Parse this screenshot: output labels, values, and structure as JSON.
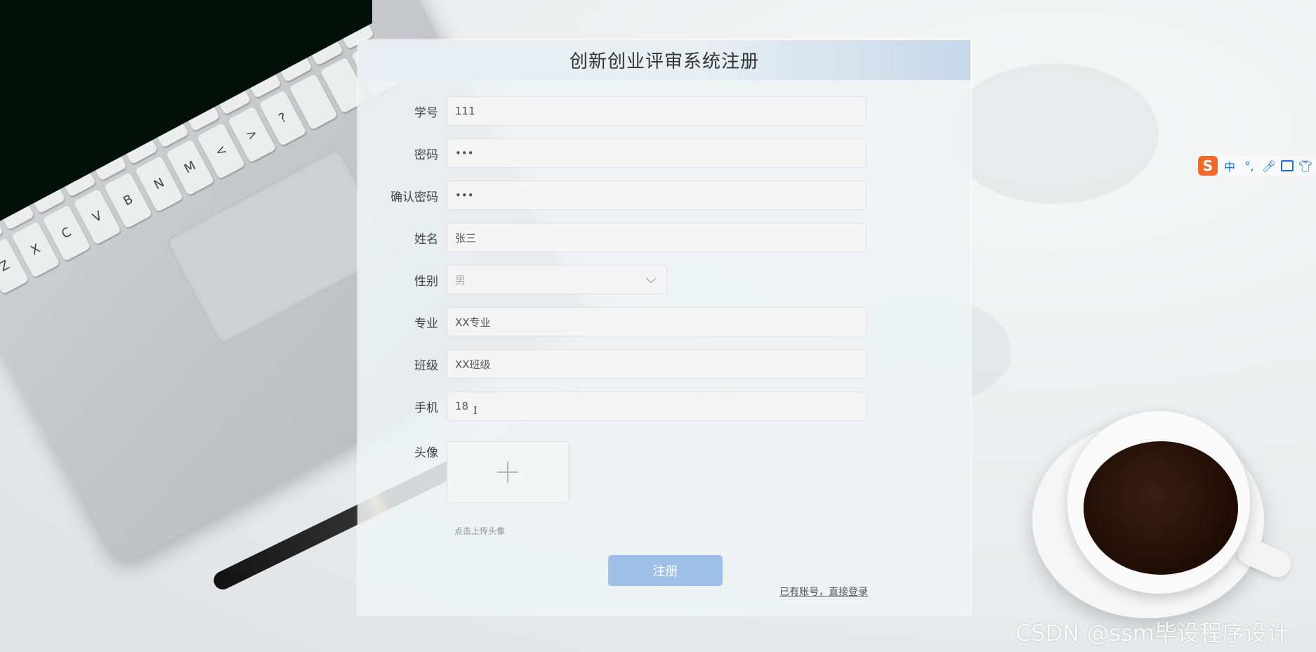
{
  "page": {
    "title": "创新创业评审系统注册"
  },
  "form": {
    "fields": [
      {
        "label": "学号",
        "value": "111"
      },
      {
        "label": "密码",
        "value": "•••"
      },
      {
        "label": "确认密码",
        "value": "•••"
      },
      {
        "label": "姓名",
        "value": "张三"
      },
      {
        "label": "性别",
        "value": "男"
      },
      {
        "label": "专业",
        "value": "XX专业"
      },
      {
        "label": "班级",
        "value": "XX班级"
      },
      {
        "label": "手机",
        "value": "18"
      }
    ],
    "avatar": {
      "label": "头像",
      "hint": "点击上传头像",
      "icon": "plus-icon"
    },
    "register_button": "注册",
    "login_link": "已有账号，直接登录"
  },
  "ime_toolbar": {
    "logo": "S",
    "mode": "中",
    "punct": "°,",
    "icons": [
      "sogou-logo-icon",
      "mic-icon",
      "keyboard-icon",
      "skin-icon"
    ]
  },
  "watermark": "CSDN @ssm毕设程序设计",
  "colors": {
    "primary_button": "#9fc0e8",
    "header_gradient_end": "#c7d8e9",
    "ime_accent": "#1d6fd6",
    "ime_logo": "#f2692a"
  }
}
